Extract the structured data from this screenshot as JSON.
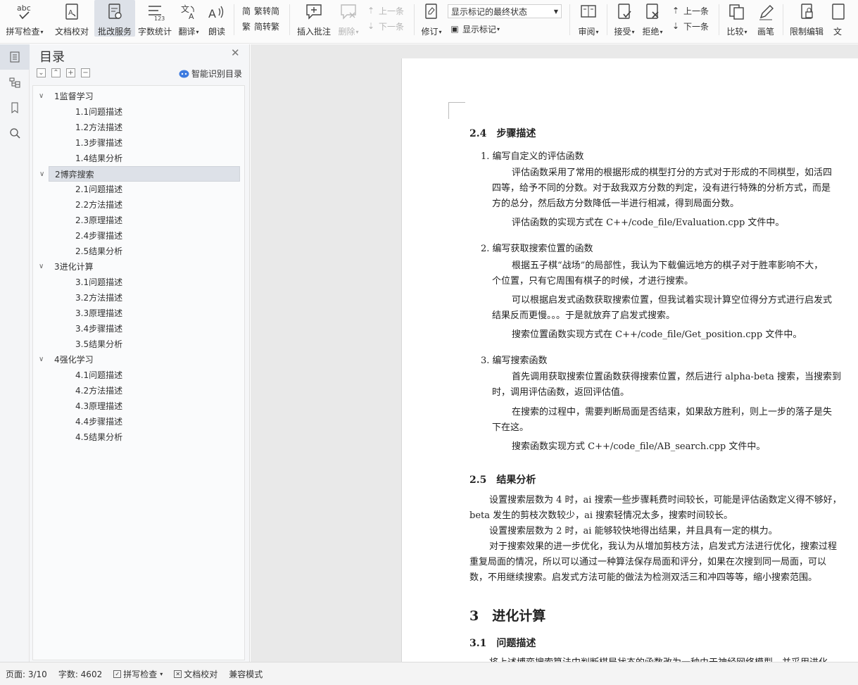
{
  "ribbon": {
    "spell_check": "拼写检查",
    "doc_proof": "文档校对",
    "batch_service": "批改服务",
    "word_count": "字数统计",
    "translate": "翻译",
    "read_aloud": "朗读",
    "trad_to_simp": "繁转简",
    "simp_to_trad": "简转繁",
    "insert_comment": "插入批注",
    "delete": "删除",
    "prev_comment": "上一条",
    "next_comment": "下一条",
    "revise": "修订",
    "markup_select": "显示标记的最终状态",
    "show_markup": "显示标记",
    "review": "审阅",
    "accept": "接受",
    "reject": "拒绝",
    "prev_change": "上一条",
    "next_change": "下一条",
    "compare": "比较",
    "pen": "画笔",
    "restrict_edit": "限制编辑",
    "doc_more": "文"
  },
  "toc": {
    "title": "目录",
    "smart_label": "智能识别目录",
    "items": [
      {
        "text": "1监督学习",
        "level": 1
      },
      {
        "text": "1.1问题描述",
        "level": 2
      },
      {
        "text": "1.2方法描述",
        "level": 2
      },
      {
        "text": "1.3步骤描述",
        "level": 2
      },
      {
        "text": "1.4结果分析",
        "level": 2
      },
      {
        "text": "2博弈搜索",
        "level": 1,
        "selected": true
      },
      {
        "text": "2.1问题描述",
        "level": 2
      },
      {
        "text": "2.2方法描述",
        "level": 2
      },
      {
        "text": "2.3原理描述",
        "level": 2
      },
      {
        "text": "2.4步骤描述",
        "level": 2
      },
      {
        "text": "2.5结果分析",
        "level": 2
      },
      {
        "text": "3进化计算",
        "level": 1
      },
      {
        "text": "3.1问题描述",
        "level": 2
      },
      {
        "text": "3.2方法描述",
        "level": 2
      },
      {
        "text": "3.3原理描述",
        "level": 2
      },
      {
        "text": "3.4步骤描述",
        "level": 2
      },
      {
        "text": "3.5结果分析",
        "level": 2
      },
      {
        "text": "4强化学习",
        "level": 1
      },
      {
        "text": "4.1问题描述",
        "level": 2
      },
      {
        "text": "4.2方法描述",
        "level": 2
      },
      {
        "text": "4.3原理描述",
        "level": 2
      },
      {
        "text": "4.4步骤描述",
        "level": 2
      },
      {
        "text": "4.5结果分析",
        "level": 2
      }
    ]
  },
  "doc": {
    "h_24": "2.4　步骤描述",
    "item1_title": "1. 编写自定义的评估函数",
    "p1a": "评估函数采用了常用的根据形成的棋型打分的方式对于形成的不同棋型，如活四",
    "p1b": "四等，给予不同的分数。对于敌我双方分数的判定，没有进行特殊的分析方式，而是",
    "p1c": "方的总分，然后敌方分数降低一半进行相减，得到局面分数。",
    "p1d": "评估函数的实现方式在 C++/code_file/Evaluation.cpp 文件中。",
    "item2_title": "2. 编写获取搜索位置的函数",
    "p2a": "根据五子棋“战场”的局部性，我认为下载偏远地方的棋子对于胜率影响不大，",
    "p2b": "个位置，只有它周围有棋子的时候，才进行搜索。",
    "p2c": "可以根据启发式函数获取搜索位置，但我试着实现计算空位得分方式进行启发式",
    "p2d": "结果反而更慢。。。于是就放弃了启发式搜索。",
    "p2e": "搜索位置函数实现方式在 C++/code_file/Get_position.cpp 文件中。",
    "item3_title": "3. 编写搜索函数",
    "p3a": "首先调用获取搜索位置函数获得搜索位置，然后进行 alpha-beta 搜索，当搜索到",
    "p3b": "时，调用评估函数，返回评估值。",
    "p3c": "在搜索的过程中，需要判断局面是否结束，如果敌方胜利，则上一步的落子是失",
    "p3d": "下在这。",
    "p3e": "搜索函数实现方式 C++/code_file/AB_search.cpp 文件中。",
    "h_25": "2.5　结果分析",
    "r1a": "设置搜索层数为 4 时，ai 搜索一些步骤耗费时间较长，可能是评估函数定义得不够好，",
    "r1b": "beta 发生的剪枝次数较少，ai 搜索轻情况太多，搜索时间较长。",
    "r2": "设置搜索层数为 2 时，ai 能够较快地得出结果，并且具有一定的棋力。",
    "r3a": "对于搜索效果的进一步优化，我认为从增加剪枝方法，启发式方法进行优化，搜索过程",
    "r3b": "重复局面的情况，所以可以通过一种算法保存局面和评分，如果在次搜到同一局面，可以",
    "r3c": "数，不用继续搜索。启发式方法可能的做法为检测双活三和冲四等等，缩小搜索范围。",
    "h_3": "3　进化计算",
    "h_31": "3.1　问题描述",
    "tail": "将上述博弈搜索算法中判断棋局状态的函数改为一种由于神经网络模型，并采用进化"
  },
  "status": {
    "page": "页面: 3/10",
    "words": "字数: 4602",
    "spell": "拼写检查",
    "proof": "文档校对",
    "compat": "兼容模式"
  }
}
